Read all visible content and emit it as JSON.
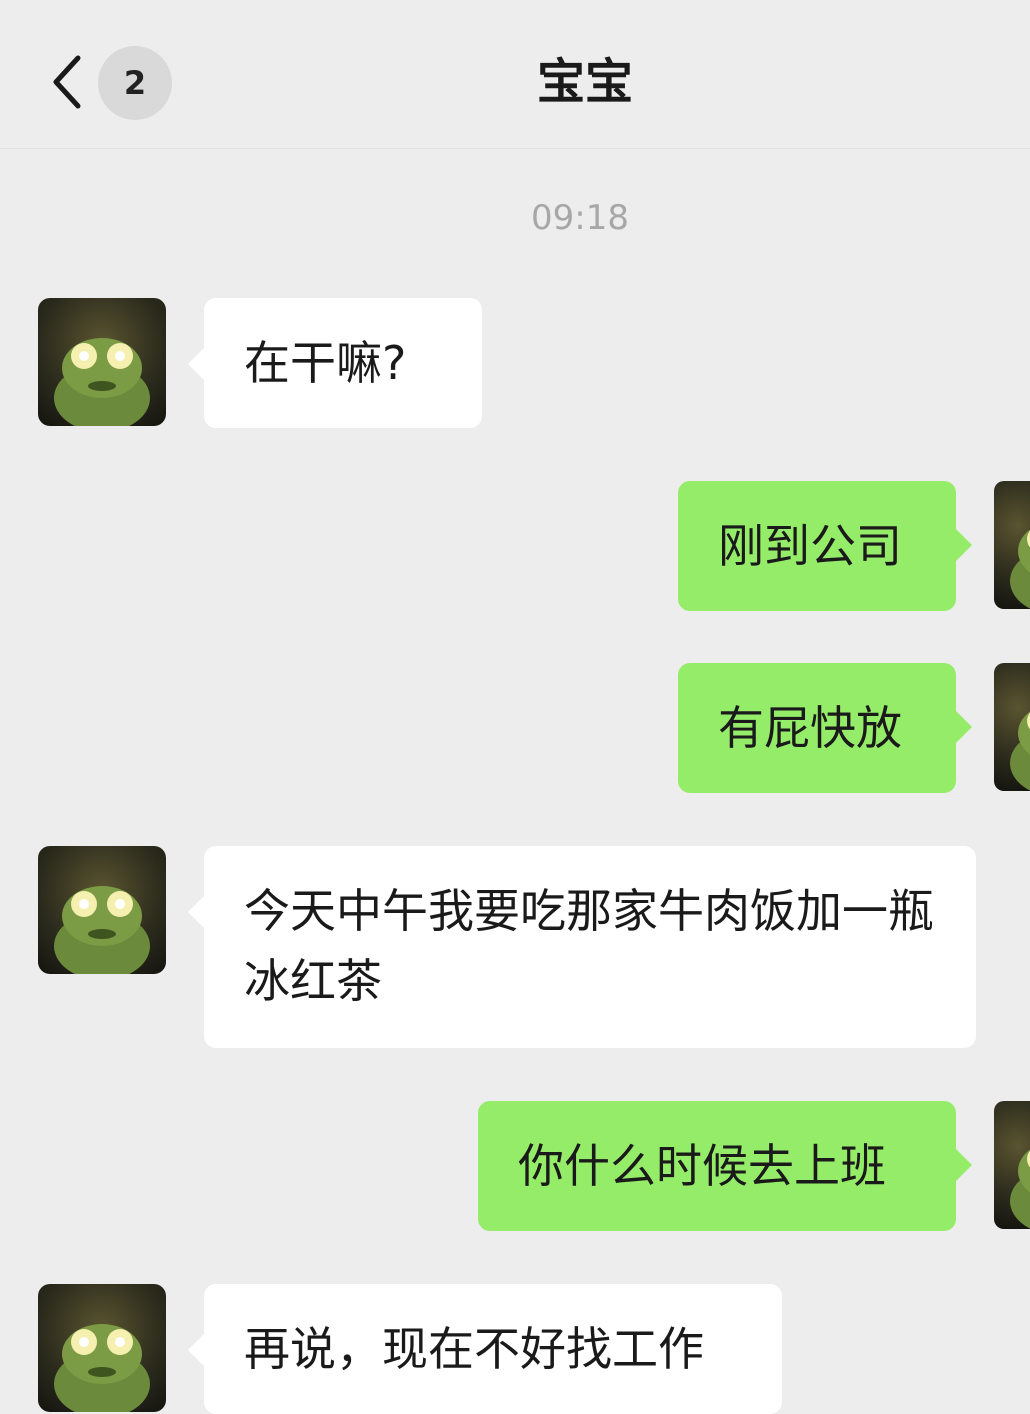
{
  "header": {
    "back_icon": "chevron-left-icon",
    "unread_count": "2",
    "title": "宝宝"
  },
  "chat": {
    "timestamp": "09:18",
    "messages": [
      {
        "side": "left",
        "text": "在干嘛?"
      },
      {
        "side": "right",
        "text": "刚到公司"
      },
      {
        "side": "right",
        "text": "有屁快放"
      },
      {
        "side": "left",
        "text": "今天中午我要吃那家牛肉饭加一瓶冰红茶"
      },
      {
        "side": "right",
        "text": "你什么时候去上班"
      },
      {
        "side": "left",
        "text": "再说，现在不好找工作"
      }
    ]
  },
  "colors": {
    "background": "#ededed",
    "bubble_self": "#95ec69",
    "bubble_other": "#ffffff"
  }
}
